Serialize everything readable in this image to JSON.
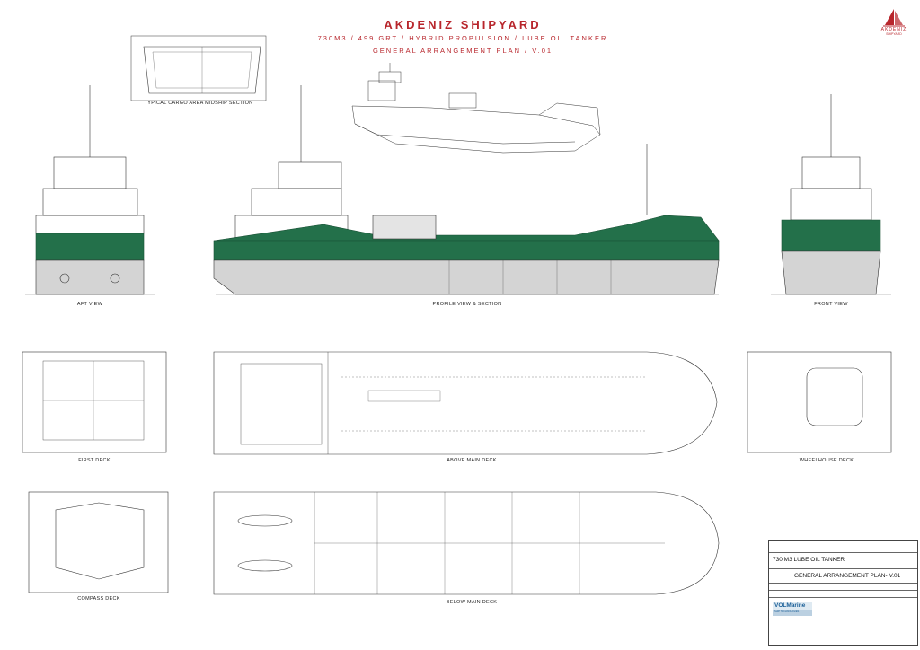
{
  "header": {
    "company": "AKDENIZ SHIPYARD",
    "subtitle": "730M3 / 499 GRT / HYBRID PROPULSION /  LUBE OIL TANKER",
    "plan": "GENERAL ARRANGEMENT PLAN / V.01"
  },
  "logo": {
    "name": "AKDENIZ",
    "sub": "SHIPYARD"
  },
  "views": {
    "midship": "TYPICAL CARGO AREA MIDSHIP SECTION",
    "aft": "AFT VIEW",
    "profile": "PROFILE VIEW & SECTION",
    "front": "FRONT VIEW",
    "first_deck": "FIRST DECK",
    "above_main": "ABOVE MAIN DECK",
    "wheelhouse": "WHEELHOUSE DECK",
    "compass": "COMPASS DECK",
    "below_main": "BELOW MAIN DECK"
  },
  "title_block": {
    "line1": "730 M3 LUBE OIL TANKER",
    "line2": "GENERAL ARRANGEMENT PLAN- V.01",
    "vol_brand": "VOLMarine",
    "vol_sub": "SHIP TECHNOLOGIES"
  },
  "colors": {
    "accent": "#b8262c",
    "hull_green": "#23704a",
    "hull_grey": "#d4d4d4",
    "line": "#333333"
  }
}
